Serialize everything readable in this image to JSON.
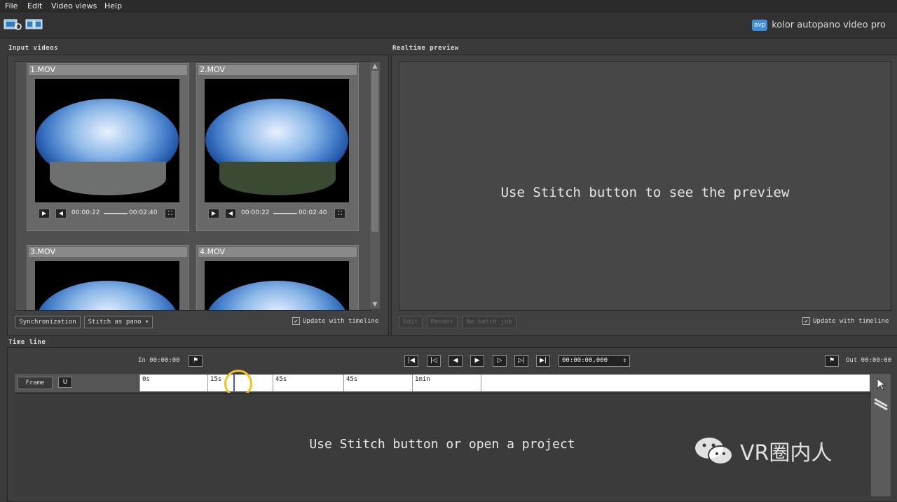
{
  "menu": [
    "File",
    "Edit",
    "Video views",
    "Help"
  ],
  "brand": {
    "logo_text": "avp",
    "name": "kolor autopano video pro"
  },
  "input_videos": {
    "title": "Input videos",
    "videos": [
      {
        "name": "1.MOV",
        "current": "00:00:22",
        "duration": "00:02:40"
      },
      {
        "name": "2.MOV",
        "current": "00:00:22",
        "duration": "00:02:40"
      },
      {
        "name": "3.MOV"
      },
      {
        "name": "4.MOV"
      }
    ],
    "sync_button": "Synchronization",
    "stitch_dropdown": "Stitch as pano",
    "update_checkbox": "Update with timeline"
  },
  "realtime_preview": {
    "title": "Realtime preview",
    "message": "Use Stitch button to see the preview",
    "edit_button": "Edit",
    "render_button": "Render",
    "batch_button": "No batch job",
    "update_checkbox": "Update with timeline"
  },
  "timeline": {
    "title": "Time line",
    "in_label": "In 00:00:00",
    "out_label": "Out 00:00:00",
    "timecode": "00:00:00,000",
    "frame_button": "Frame",
    "ticks": [
      "0s",
      "15s",
      "45s",
      "45s",
      "1min"
    ],
    "message": "Use Stitch button or open a project"
  },
  "watermark": "VR圈内人",
  "colors": {
    "highlight": "#f4c219",
    "playhead": "#4a56d8",
    "accent": "#3d8fd6"
  }
}
